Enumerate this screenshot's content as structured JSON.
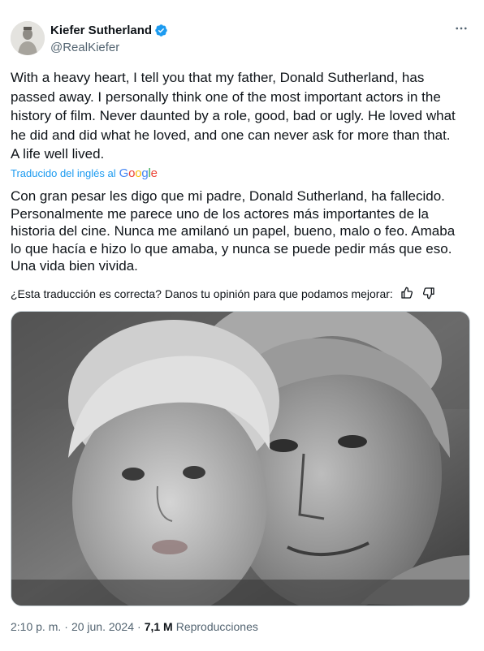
{
  "author": {
    "display_name": "Kiefer Sutherland",
    "handle": "@RealKiefer",
    "verified": true,
    "verified_color": "#1d9bf0"
  },
  "more_icon": "more-horizontal-icon",
  "tweet": {
    "text": "With a heavy heart, I tell you that my father, Donald Sutherland, has\npassed away. I personally think one of the most important actors in the\nhistory of film. Never daunted by a role, good, bad or ugly. He loved what\nhe did and did what he loved, and one can never ask for more than that.\nA life well lived."
  },
  "translation": {
    "label": "Traducido del inglés al",
    "provider_letters": [
      "G",
      "o",
      "o",
      "g",
      "l",
      "e"
    ],
    "text": "Con gran pesar les digo que mi padre, Donald Sutherland, ha fallecido.\nPersonalmente me parece uno de los actores más importantes de la\nhistoria del cine. Nunca me amilanó un papel, bueno, malo o feo. Amaba\nlo que hacía e hizo lo que amaba, y nunca se puede pedir más que eso.\nUna vida bien vivida.",
    "feedback_prompt": "¿Esta traducción es correcta? Danos tu opinión para que podamos mejorar:",
    "thumbs_up_icon": "thumbs-up-icon",
    "thumbs_down_icon": "thumbs-down-icon"
  },
  "media": {
    "type": "black-and-white photo"
  },
  "meta": {
    "time": "2:10 p. m.",
    "date": "20 jun. 2024",
    "separator_1": "·",
    "separator_2": "·",
    "views_count": "7,1 M",
    "views_label": "Reproducciones"
  },
  "colors": {
    "text_primary": "#0f1419",
    "text_secondary": "#536471",
    "link": "#1d9bf0"
  }
}
